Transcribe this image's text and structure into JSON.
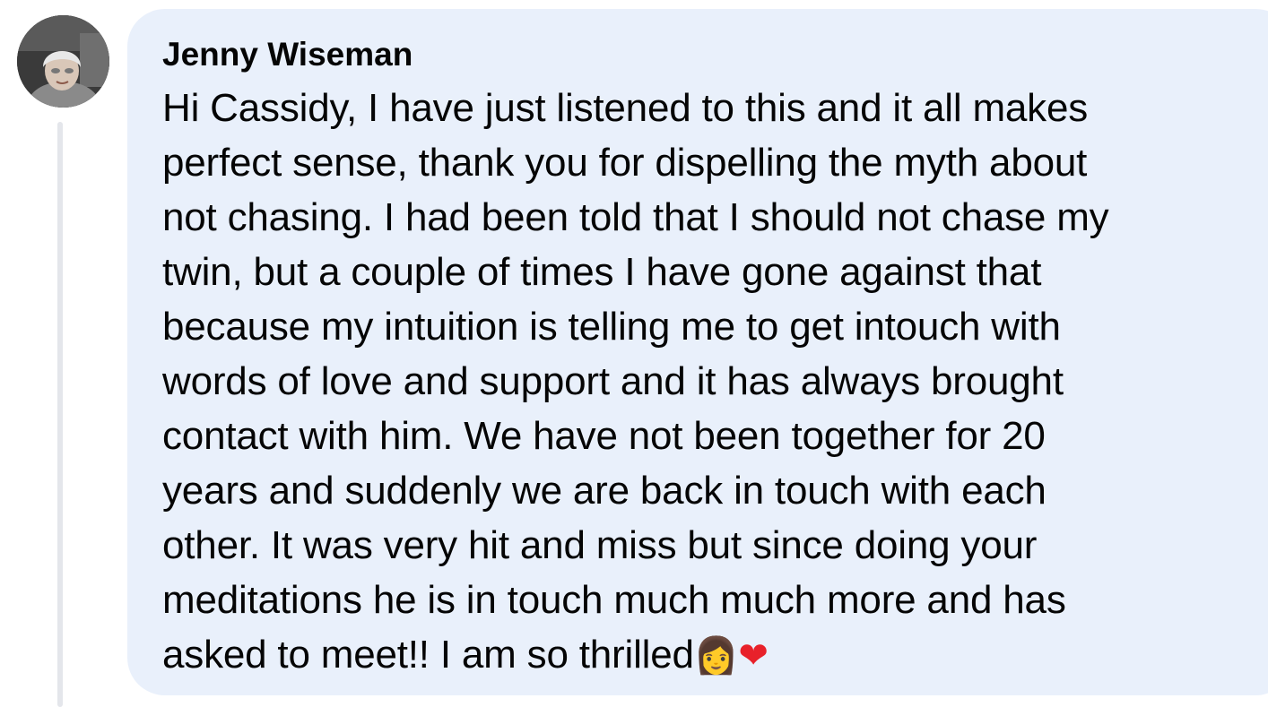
{
  "comment": {
    "author": "Jenny Wiseman",
    "body_lines": [
      "Hi Cassidy, I have just listened to this and it all makes",
      "perfect sense, thank you for dispelling the myth about",
      "not chasing. I had been told that I should not chase my",
      "twin, but a couple of times I have gone against that",
      "because my intuition is telling me to get intouch with",
      "words of love and support and it has always brought",
      "contact with him. We have not been together for 20",
      "years and suddenly we are back in touch with each",
      "other. It was very hit and miss but since doing your",
      "meditations he is in touch much much more and has",
      "asked to meet!! I am so thrilled"
    ],
    "emojis": {
      "woman": "👩",
      "heart": "❤"
    }
  },
  "colors": {
    "bubble_background": "#e9f0fb",
    "text": "#050505",
    "thread_line": "#e4e6eb"
  },
  "icons": {
    "avatar": "profile-photo"
  }
}
